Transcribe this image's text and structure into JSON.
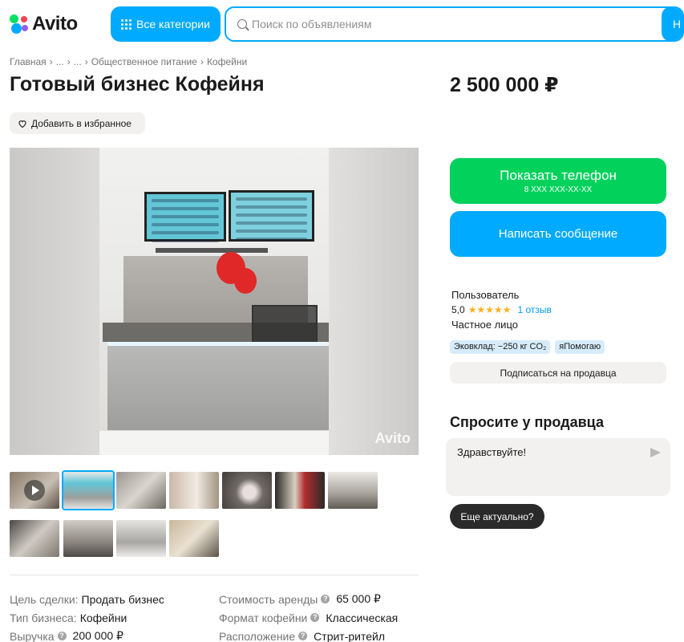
{
  "header": {
    "logo_text": "Avito",
    "categories_label": "Все категории",
    "search_placeholder": "Поиск по объявлениям",
    "search_button_label": "Н"
  },
  "breadcrumb": [
    "Главная",
    "...",
    "...",
    "Общественное питание",
    "Кофейни"
  ],
  "listing": {
    "title": "Готовый бизнес Кофейня",
    "price": "2 500 000 ₽",
    "favorite_label": "Добавить в избранное",
    "watermark": "Avito"
  },
  "params_left": [
    {
      "key": "Цель сделки:",
      "value": "Продать бизнес",
      "help": false
    },
    {
      "key": "Тип бизнеса:",
      "value": "Кофейни",
      "help": false
    },
    {
      "key": "Выручка",
      "value": "200 000 ₽",
      "help": true
    }
  ],
  "params_right": [
    {
      "key": "Стоимость аренды",
      "value": "65 000 ₽",
      "help": true
    },
    {
      "key": "Формат кофейни",
      "value": "Классическая",
      "help": true
    },
    {
      "key": "Расположение",
      "value": "Стрит-ритейл",
      "help": true
    }
  ],
  "contact": {
    "phone_label": "Показать телефон",
    "phone_masked": "8 XXX XXX-XX-XX",
    "message_label": "Написать сообщение"
  },
  "seller": {
    "name": "Пользователь",
    "rating": "5,0",
    "stars": "★★★★★",
    "reviews": "1 отзыв",
    "type": "Частное лицо",
    "badges": [
      "Эковклад: −250 кг CO₂",
      "яПомогаю"
    ],
    "subscribe_label": "Подписаться на продавца"
  },
  "ask": {
    "title": "Спросите у продавца",
    "message_value": "Здравствуйте!",
    "quick_reply": "Еще актуально?"
  },
  "colors": {
    "accent": "#00aaff",
    "green": "#02d15c",
    "star": "#ffb021"
  }
}
